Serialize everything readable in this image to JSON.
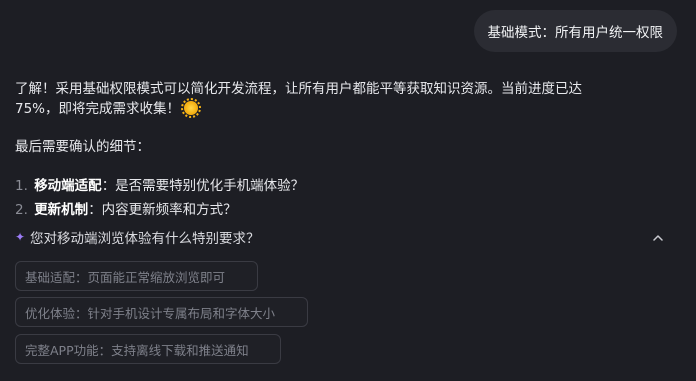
{
  "user_message": "基础模式：所有用户统一权限",
  "assistant": {
    "paragraph1": "了解！采用基础权限模式可以简化开发流程，让所有用户都能平等获取知识资源。当前进度已达75%，即将完成需求收集！",
    "emoji_icon": "sun-emoji",
    "paragraph2": "最后需要确认的细节：",
    "list": [
      {
        "num": "1.",
        "term": "移动端适配",
        "desc": "：是否需要特别优化手机端体验？"
      },
      {
        "num": "2.",
        "term": "更新机制",
        "desc": "：内容更新频率和方式？"
      }
    ]
  },
  "followup": {
    "icon": "sparkle",
    "question": "您对移动端浏览体验有什么特别要求？",
    "options": [
      "基础适配：页面能正常缩放浏览即可",
      "优化体验：针对手机设计专属布局和字体大小",
      "完整APP功能：支持离线下载和推送通知"
    ]
  },
  "colors": {
    "background": "#1d1e24",
    "user_bubble": "#2b2c33",
    "sparkle": "#9b7cf7",
    "option_border": "#3a3b43"
  }
}
